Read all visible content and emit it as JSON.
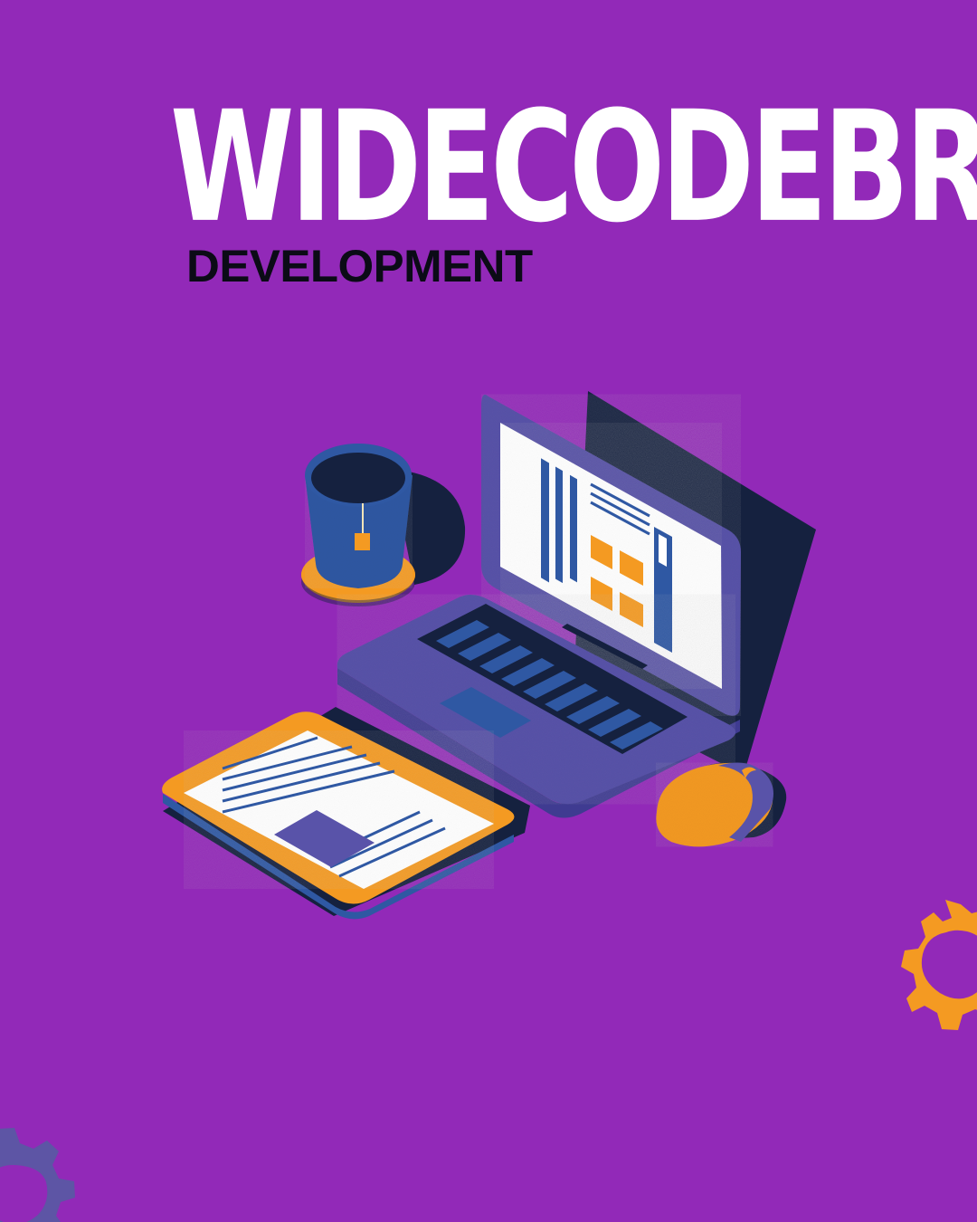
{
  "header": {
    "title": "WIDECODEBR",
    "subtitle": "DEVELOPMENT"
  },
  "illustration": {
    "objects": [
      "laptop",
      "tea-cup",
      "tablet",
      "mouse"
    ],
    "decorative_icons": [
      "gear-icon",
      "gear-icon"
    ]
  },
  "colors": {
    "background": "#9229b8",
    "title": "#ffffff",
    "subtitle": "#0b0b16",
    "laptop": "#5953a9",
    "navy": "#15213f",
    "blue": "#2f58a3",
    "orange": "#f49a22",
    "paper": "#ffffff",
    "accent_purple": "#5d55a5"
  }
}
